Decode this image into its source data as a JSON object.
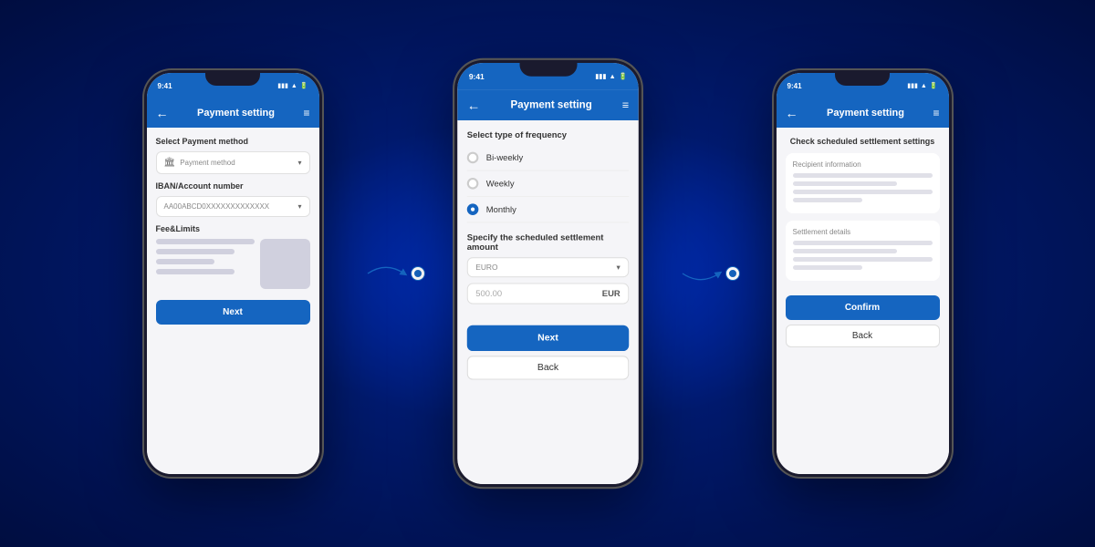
{
  "colors": {
    "primary": "#1565c0",
    "background_dark": "#001a6e",
    "surface": "#f5f5f8",
    "white": "#ffffff"
  },
  "phone1": {
    "time": "9:41",
    "header_title": "Payment setting",
    "back_label": "←",
    "menu_label": "≡",
    "section1_label": "Select Payment method",
    "dropdown1_placeholder": "Payment method",
    "section2_label": "IBAN/Account number",
    "dropdown2_value": "AA00ABCD0XXXXXXXXXXXXX",
    "section3_label": "Fee&Limits",
    "next_label": "Next"
  },
  "phone2": {
    "time": "9:41",
    "header_title": "Payment setting",
    "back_label": "←",
    "menu_label": "≡",
    "frequency_label": "Select type of frequency",
    "option1": "Bi-weekly",
    "option2": "Weekly",
    "option3": "Monthly",
    "amount_label": "Specify the scheduled settlement amount",
    "currency": "EURO",
    "amount_placeholder": "500.00",
    "currency_code": "EUR",
    "next_label": "Next",
    "back_btn_label": "Back"
  },
  "phone3": {
    "time": "9:41",
    "header_title": "Payment setting",
    "back_label": "←",
    "menu_label": "≡",
    "check_title": "Check scheduled settlement settings",
    "recipient_section_title": "Recipient information",
    "settlement_section_title": "Settlement details",
    "confirm_label": "Confirm",
    "back_btn_label": "Back"
  }
}
